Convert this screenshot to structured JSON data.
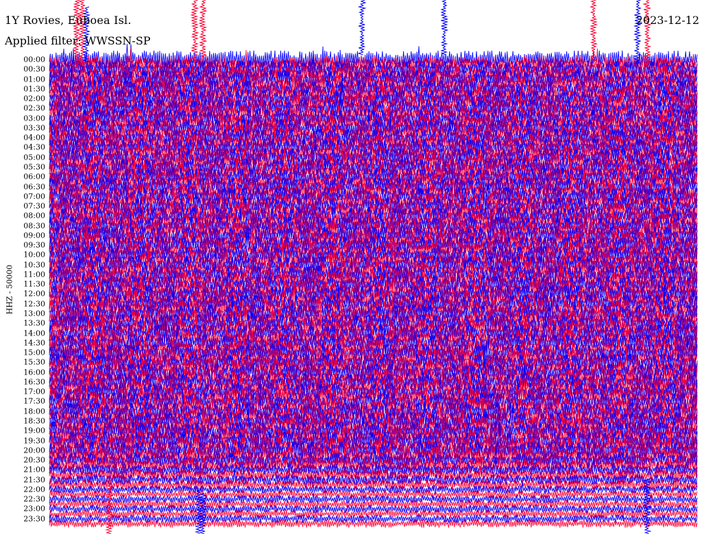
{
  "header": {
    "station": "1Y Rovies, Euboea Isl.",
    "filter": "Applied filter: WWSSN-SP",
    "date": "2023-12-12"
  },
  "channel_label": "HHZ - 50000",
  "colors": {
    "trace_a": "#0000ff",
    "trace_b": "#ff0033",
    "background": "#ffffff"
  },
  "chart_data": {
    "type": "helicorder",
    "title": "1Y Rovies, Euboea Isl.",
    "subtitle": "Applied filter: WWSSN-SP",
    "date": "2023-12-12",
    "ylabel": "HHZ - 50000",
    "minutes_per_line": 15,
    "line_colors_alternate": [
      "#0000ff",
      "#ff0033"
    ],
    "row_labels": [
      "00:00",
      "00:30",
      "01:00",
      "01:30",
      "02:00",
      "02:30",
      "03:00",
      "03:30",
      "04:00",
      "04:30",
      "05:00",
      "05:30",
      "06:00",
      "06:30",
      "07:00",
      "07:30",
      "08:00",
      "08:30",
      "09:00",
      "09:30",
      "10:00",
      "10:30",
      "11:00",
      "11:30",
      "12:00",
      "12:30",
      "13:00",
      "13:30",
      "14:00",
      "14:30",
      "15:00",
      "15:30",
      "16:00",
      "16:30",
      "17:00",
      "17:30",
      "18:00",
      "18:30",
      "19:00",
      "19:30",
      "20:00",
      "20:30",
      "21:00",
      "21:30",
      "22:00",
      "22:30",
      "23:00",
      "23:30"
    ],
    "amplitude_level_by_row": [
      1.0,
      1.0,
      1.0,
      1.0,
      1.0,
      1.0,
      1.0,
      1.0,
      1.0,
      1.0,
      1.0,
      1.0,
      1.0,
      1.0,
      1.0,
      1.0,
      1.0,
      1.0,
      1.0,
      1.0,
      1.0,
      1.0,
      1.0,
      1.0,
      1.0,
      1.0,
      1.0,
      1.0,
      1.0,
      1.0,
      1.0,
      1.0,
      1.0,
      1.0,
      1.0,
      1.0,
      1.0,
      1.0,
      1.0,
      1.0,
      1.0,
      0.8,
      0.6,
      0.5,
      0.3,
      0.3,
      0.3,
      0.3
    ]
  }
}
